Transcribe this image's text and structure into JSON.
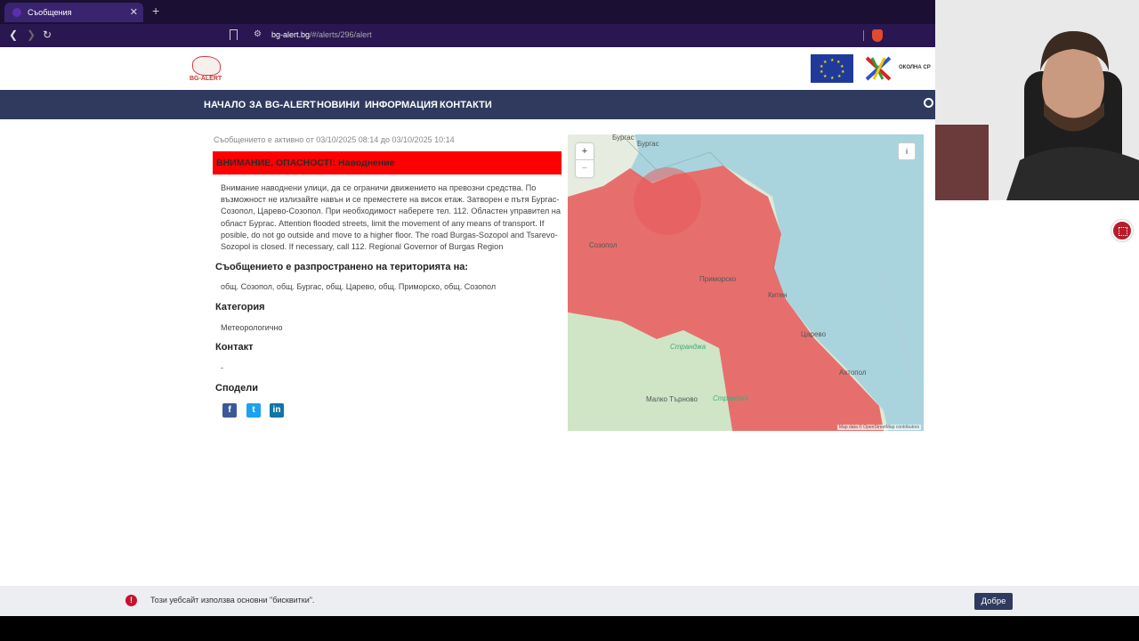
{
  "browser": {
    "tab_title": "Съобщения",
    "url_domain": "bg-alert.bg",
    "url_path": "/#/alerts/296/alert"
  },
  "site": {
    "logo_text": "BG-ALERT",
    "partner_text": "ОКОЛНА СР"
  },
  "nav": [
    "НАЧАЛО",
    "ЗА BG-ALERT",
    "НОВИНИ",
    "ИНФОРМАЦИЯ",
    "КОНТАКТИ"
  ],
  "alert": {
    "active_text": "Съобщението е активно от 03/10/2025 08:14 до 03/10/2025 10:14",
    "title": "ВНИМАНИЕ, ОПАСНОСТ!: Наводнение",
    "description": "Внимание наводнени улици, да се ограничи движението на превозни средства. По възможност не излизайте навън и се преместете на висок етаж. Затворен е пътя Бургас-Созопол, Царево-Созопол. При необходимост наберете тел. 112. Областен управител на област Бургас. Attention flooded streets, limit the movement of any means of transport. If posible, do not go outside and move to a higher floor. The road Burgas-Sozopol and Tsarevo-Sozopol is closed. If necessary, call 112. Regional Governor of Burgas Region",
    "territory_heading": "Съобщението е разпространено на територията на:",
    "territory": "общ. Созопол, общ. Бургас, общ. Царево, общ. Приморско, общ. Созопол",
    "category_heading": "Категория",
    "category": "Метеорологично",
    "contact_heading": "Контакт",
    "contact": "-",
    "share_heading": "Сподели"
  },
  "map": {
    "zoom_in": "+",
    "zoom_out": "−",
    "info": "i",
    "attribution": "Map data © OpenStreetMap contributors",
    "labels": [
      "Бургас",
      "Созопол",
      "Приморско",
      "Странджа",
      "Царево",
      "Ахтопол",
      "Малко Търново",
      "Странджа",
      "Китен"
    ],
    "colors": {
      "sea": "#a9d4de",
      "land": "#e4eedd",
      "alert": "#e8595b"
    }
  },
  "cookie": {
    "message": "Този уебсайт използва основни \"бисквитки\".",
    "button": "Добре"
  }
}
